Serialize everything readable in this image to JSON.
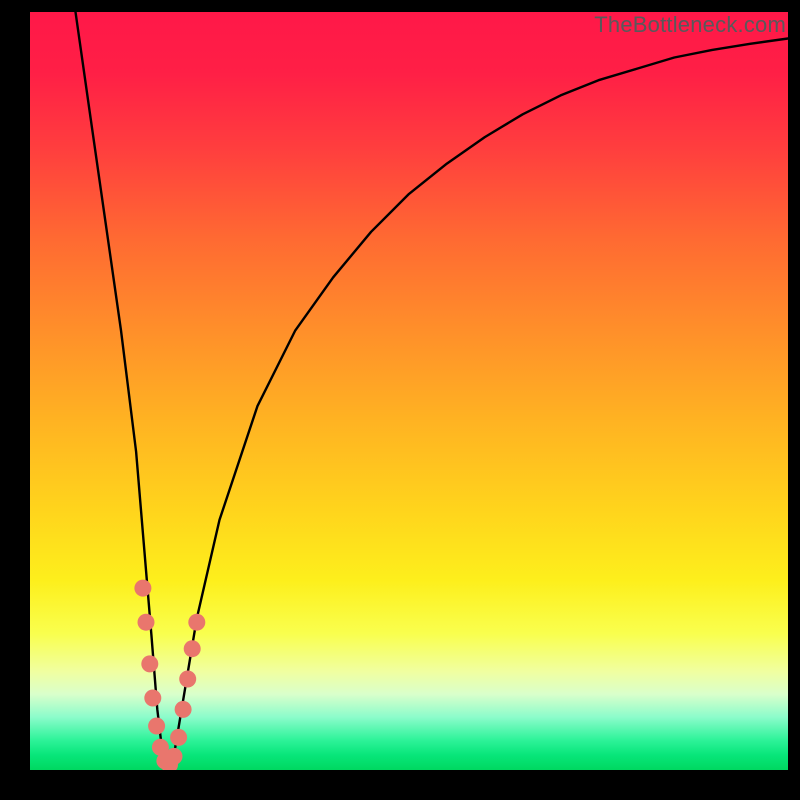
{
  "watermark": "TheBottleneck.com",
  "chart_data": {
    "type": "line",
    "title": "",
    "xlabel": "",
    "ylabel": "",
    "xlim": [
      0,
      100
    ],
    "ylim": [
      0,
      100
    ],
    "grid": false,
    "legend": false,
    "series": [
      {
        "name": "bottleneck-curve",
        "x": [
          6,
          8,
          10,
          12,
          14,
          15,
          16,
          16.8,
          17.5,
          18.2,
          19,
          20,
          22,
          25,
          30,
          35,
          40,
          45,
          50,
          55,
          60,
          65,
          70,
          75,
          80,
          85,
          90,
          95,
          100
        ],
        "y": [
          100,
          86,
          72,
          58,
          42,
          30,
          18,
          8,
          2,
          0.5,
          2,
          8,
          20,
          33,
          48,
          58,
          65,
          71,
          76,
          80,
          83.5,
          86.5,
          89,
          91,
          92.5,
          94,
          95,
          95.8,
          96.5
        ]
      }
    ],
    "markers_cluster": {
      "name": "highlighted-points",
      "color": "#e9766d",
      "points": [
        {
          "x": 14.9,
          "y": 24.0
        },
        {
          "x": 15.3,
          "y": 19.5
        },
        {
          "x": 15.8,
          "y": 14.0
        },
        {
          "x": 16.2,
          "y": 9.5
        },
        {
          "x": 16.7,
          "y": 5.8
        },
        {
          "x": 17.2,
          "y": 3.0
        },
        {
          "x": 17.8,
          "y": 1.2
        },
        {
          "x": 18.4,
          "y": 0.7
        },
        {
          "x": 19.0,
          "y": 1.8
        },
        {
          "x": 19.6,
          "y": 4.3
        },
        {
          "x": 20.2,
          "y": 8.0
        },
        {
          "x": 20.8,
          "y": 12.0
        },
        {
          "x": 21.4,
          "y": 16.0
        },
        {
          "x": 22.0,
          "y": 19.5
        }
      ]
    },
    "background_gradient": {
      "top": "#ff1848",
      "mid": "#ffd51c",
      "bottom": "#00d860"
    }
  }
}
